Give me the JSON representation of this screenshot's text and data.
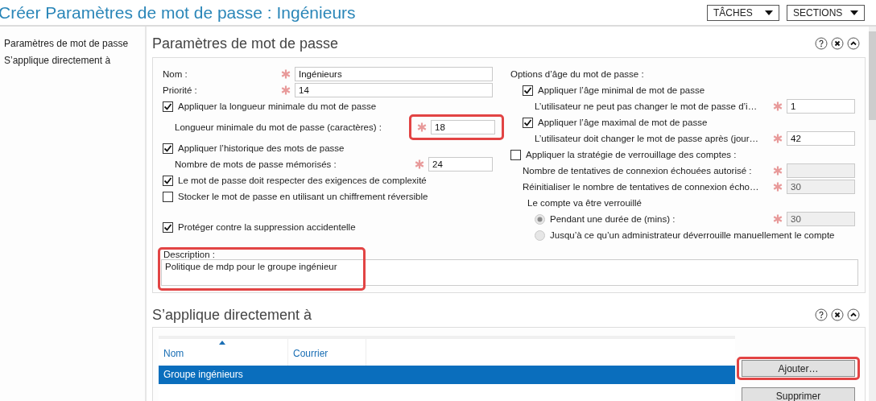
{
  "title": "Créer Paramètres de mot de passe : Ingénieurs",
  "menus": [
    {
      "label": "TÂCHES"
    },
    {
      "label": "SECTIONS"
    }
  ],
  "nav": [
    {
      "label": "Paramètres de mot de passe"
    },
    {
      "label": "S’applique directement à"
    }
  ],
  "password_section": {
    "title": "Paramètres de mot de passe",
    "left": [
      {
        "kind": "field",
        "label": "Nom :",
        "value": "Ingénieurs",
        "required": true
      },
      {
        "kind": "field",
        "label": "Priorité :",
        "value": "14",
        "required": true
      },
      {
        "kind": "checkbox",
        "label": "Appliquer la longueur minimale du mot de passe",
        "checked": true,
        "children": [
          {
            "kind": "subfield",
            "label": "Longueur minimale du mot de passe (caractères) :",
            "value": "18",
            "required": true,
            "highlighted": true
          }
        ]
      },
      {
        "kind": "checkbox",
        "label": "Appliquer l’historique des mots de passe",
        "checked": true,
        "children": [
          {
            "kind": "subfield",
            "label": "Nombre de mots de passe mémorisés :",
            "value": "24",
            "required": true
          }
        ]
      },
      {
        "kind": "checkbox",
        "label": "Le mot de passe doit respecter des exigences de complexité",
        "checked": true
      },
      {
        "kind": "checkbox",
        "label": "Stocker le mot de passe en utilisant un chiffrement réversible",
        "checked": false
      }
    ],
    "protect": {
      "label": "Protéger contre la suppression accidentelle",
      "checked": true
    },
    "right": [
      {
        "kind": "text",
        "label": "Options d’âge du mot de passe :",
        "children": [
          {
            "kind": "checkbox",
            "label": "Appliquer l’âge minimal de mot de passe",
            "checked": true,
            "children": [
              {
                "kind": "subfield",
                "label": "L’utilisateur ne peut pas changer le mot de passe d’i…",
                "value": "1",
                "required": true
              }
            ]
          },
          {
            "kind": "checkbox",
            "label": "Appliquer l’âge maximal de mot de passe",
            "checked": true,
            "children": [
              {
                "kind": "subfield",
                "label": "L’utilisateur doit changer le mot de passe après (jour…",
                "value": "42",
                "required": true
              }
            ]
          }
        ]
      },
      {
        "kind": "checkbox",
        "label": "Appliquer la stratégie de verrouillage des comptes :",
        "checked": false,
        "children": [
          {
            "kind": "subfield",
            "label": "Nombre de tentatives de connexion échouées autorisé :",
            "required": true,
            "disabled": true
          },
          {
            "kind": "subfield",
            "label": "Réinitialiser le nombre de tentatives de connexion écho…",
            "value": "30",
            "required": true,
            "disabled": true
          },
          {
            "kind": "text",
            "label": "Le compte va être verrouillé",
            "children": [
              {
                "kind": "radio",
                "label": "Pendant une durée de (mins) :",
                "selected": true,
                "disabled": true,
                "value": "30",
                "required": true
              },
              {
                "kind": "radio",
                "label": "Jusqu’à ce qu’un administrateur déverrouille manuellement le compte",
                "selected": false,
                "disabled": true
              }
            ]
          }
        ]
      }
    ],
    "description": {
      "label": "Description :",
      "value": "Politique de mdp pour le groupe ingénieur",
      "highlighted": true
    }
  },
  "applies_section": {
    "title": "S’applique directement à",
    "columns": [
      {
        "label": "Nom",
        "sorted": true
      },
      {
        "label": "Courrier",
        "sorted": false
      }
    ],
    "rows": [
      {
        "name": "Groupe ingénieurs",
        "selected": true
      }
    ],
    "buttons": [
      {
        "label": "Ajouter…",
        "highlighted": true
      },
      {
        "label": "Supprimer",
        "highlighted": false
      }
    ]
  }
}
